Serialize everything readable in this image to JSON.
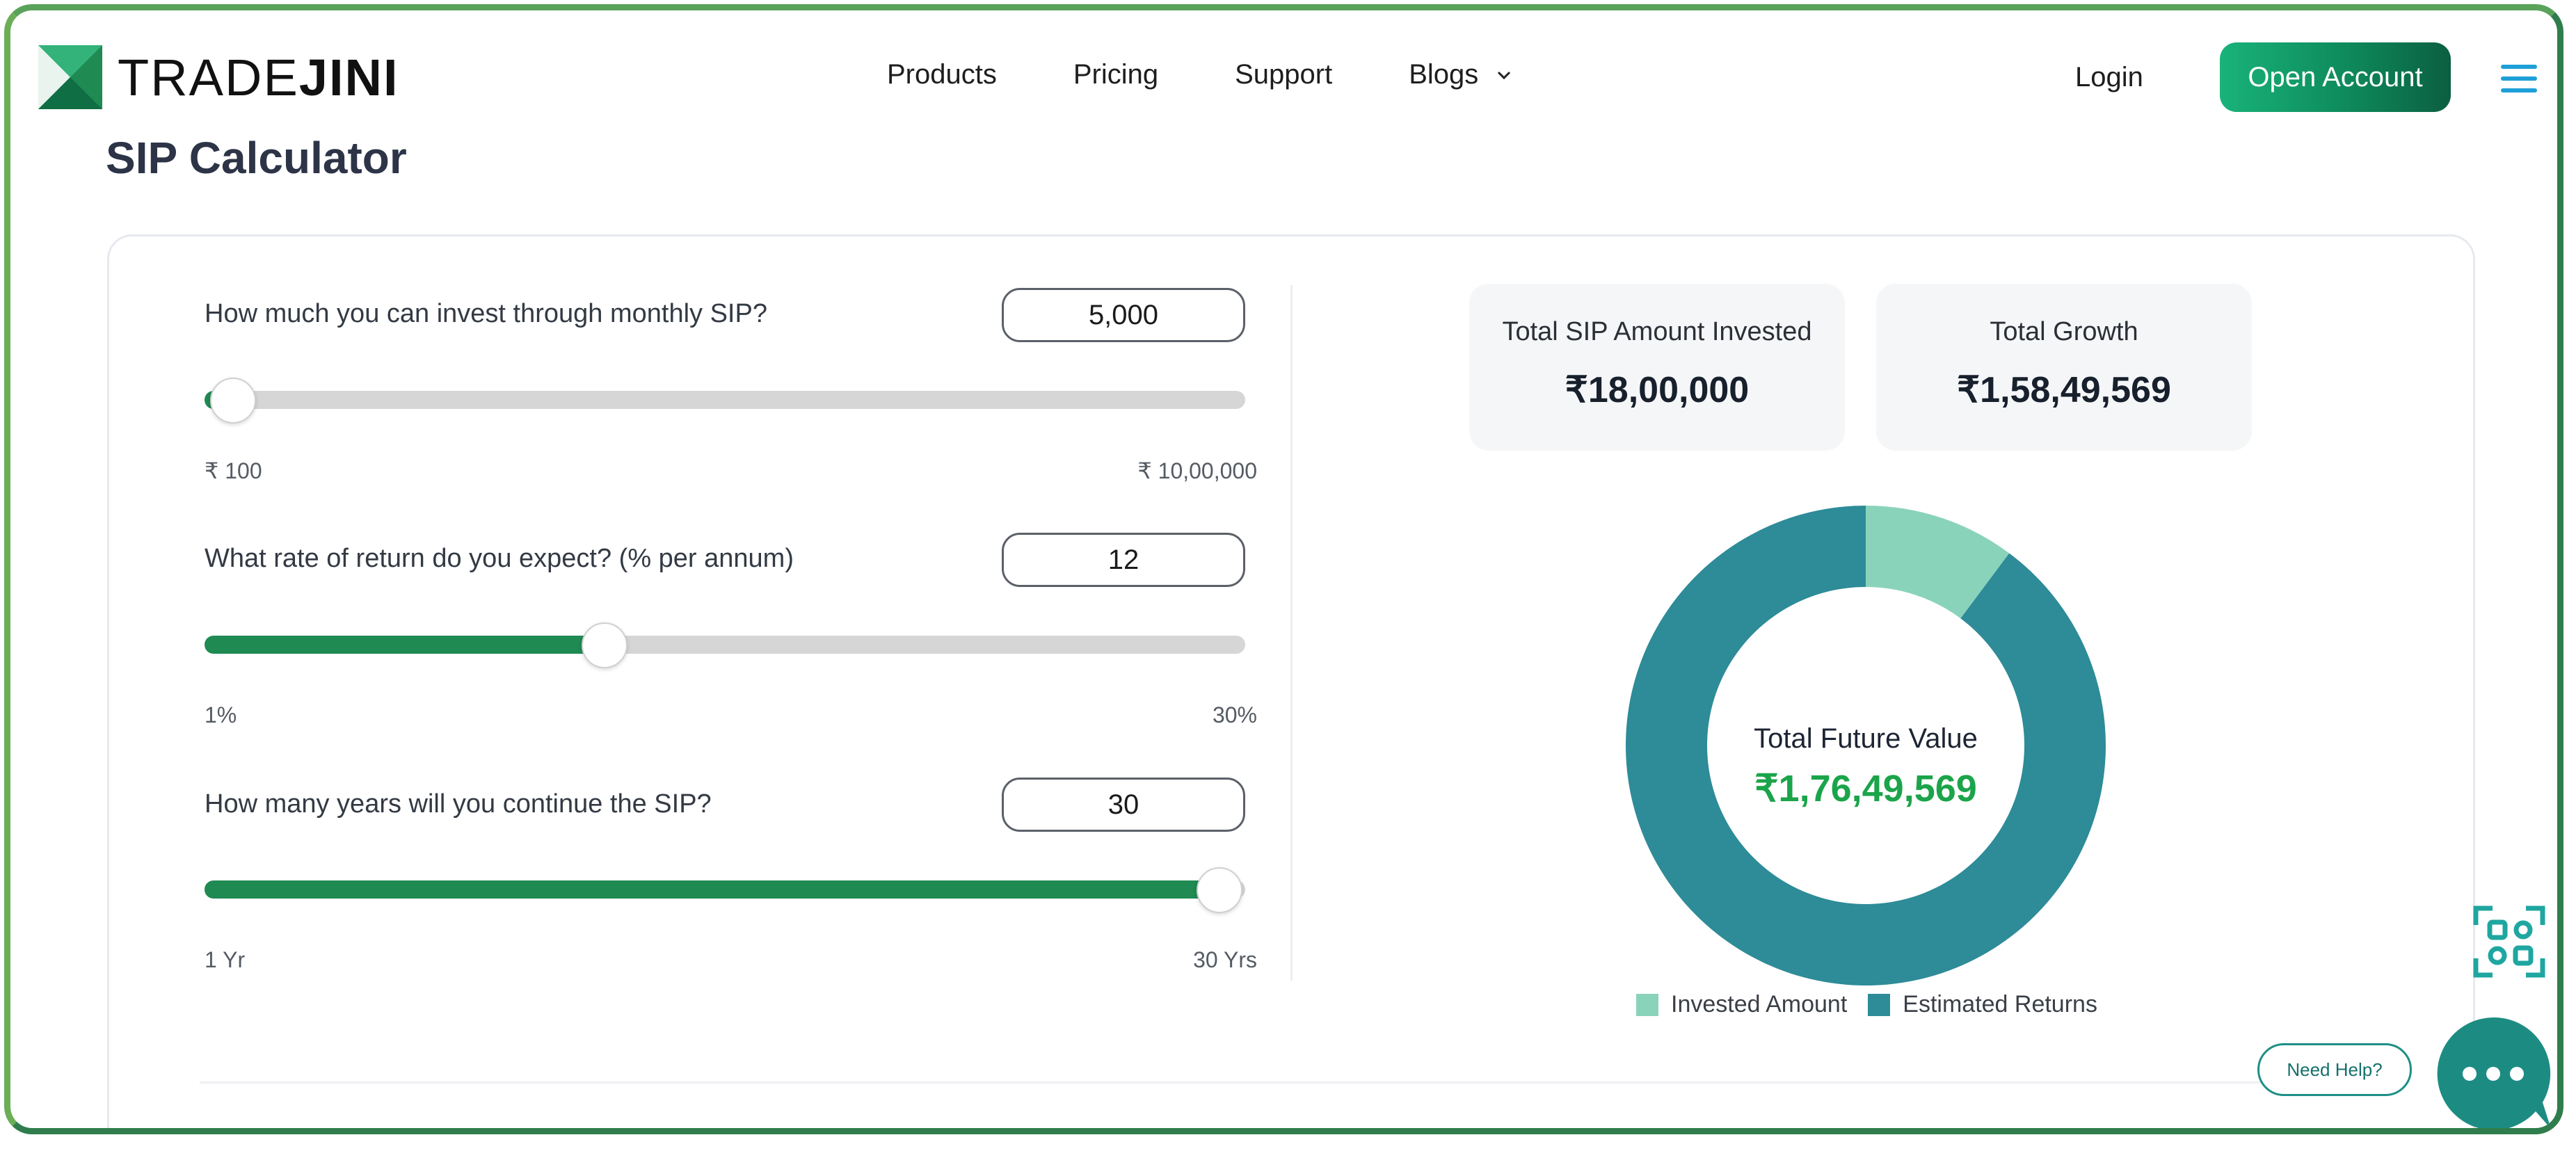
{
  "brand": {
    "name_light": "TRADE",
    "name_bold": "JINI"
  },
  "nav": {
    "links": [
      "Products",
      "Pricing",
      "Support",
      "Blogs"
    ],
    "login": "Login",
    "open_account": "Open Account"
  },
  "page": {
    "title": "SIP Calculator"
  },
  "inputs": [
    {
      "question": "How much you can invest through monthly SIP?",
      "value": "5,000",
      "min_label": "₹ 100",
      "max_label": "₹ 10,00,000",
      "slider_fraction": 0.026
    },
    {
      "question": "What rate of return do you expect? (% per annum)",
      "value": "12",
      "min_label": "1%",
      "max_label": "30%",
      "slider_fraction": 0.383
    },
    {
      "question": "How many years will you continue the SIP?",
      "value": "30",
      "min_label": "1 Yr",
      "max_label": "30 Yrs",
      "slider_fraction": 0.974
    }
  ],
  "results": {
    "invested_label": "Total SIP Amount Invested",
    "invested_value": "₹18,00,000",
    "growth_label": "Total Growth",
    "growth_value": "₹1,58,49,569",
    "future_label": "Total Future Value",
    "future_value": "₹1,76,49,569"
  },
  "chart_data": {
    "type": "pie",
    "donut": true,
    "categories": [
      "Invested Amount",
      "Estimated Returns"
    ],
    "values": [
      1800000,
      15849569
    ],
    "colors": [
      "#8ad3bb",
      "#2e8b98"
    ],
    "legend": "bottom"
  },
  "widgets": {
    "need_help": "Need Help?"
  },
  "colors": {
    "accent": "#1f8a52",
    "brand_green": "#19b37a",
    "teal": "#2e8b98",
    "future_value": "#1ba44a"
  }
}
